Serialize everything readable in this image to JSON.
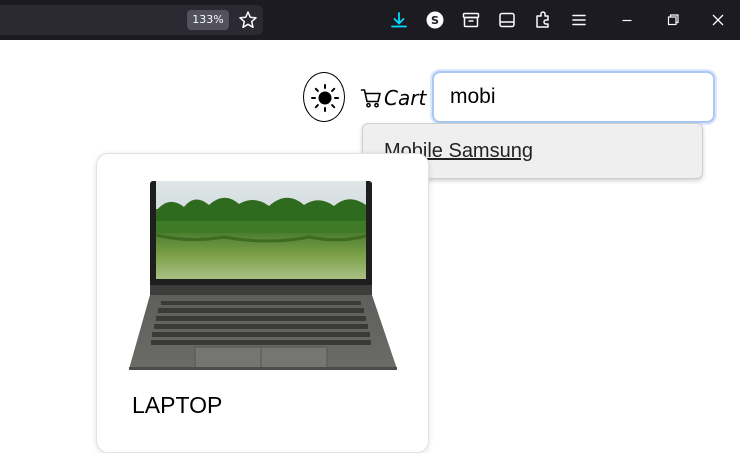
{
  "browser": {
    "zoom_level": "133%",
    "toolbar_icons": [
      "bookmark-star-icon",
      "download-icon",
      "extension-s-icon",
      "container-icon",
      "sidebar-icon",
      "extensions-icon",
      "menu-icon"
    ],
    "window_controls": [
      "minimize-icon",
      "restore-icon",
      "close-icon"
    ],
    "download_color": "#00ddff"
  },
  "header": {
    "theme_toggle_icon": "sun-icon",
    "cart_icon": "cart-icon",
    "cart_label": "Cart",
    "search_value": "mobi"
  },
  "suggestions": [
    {
      "label": "Mobile Samsung"
    }
  ],
  "products": [
    {
      "title": "LAPTOP",
      "image": "laptop-image"
    }
  ]
}
